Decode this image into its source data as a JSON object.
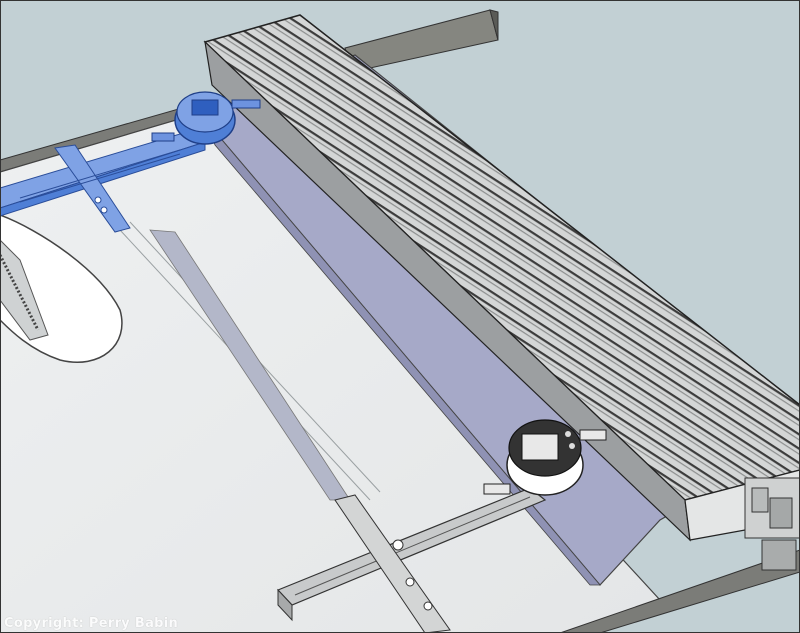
{
  "watermark": "Copyright: Perry Babin",
  "colors": {
    "background": "#c2d0d4",
    "table_top": "#e9ebec",
    "rail": "#7b7c78",
    "fence_face": "#a6a9c8",
    "extrusion": "#d4d6d6",
    "dial_gauge_blue": "#4f7fd6",
    "sled": "#c8cacb"
  }
}
